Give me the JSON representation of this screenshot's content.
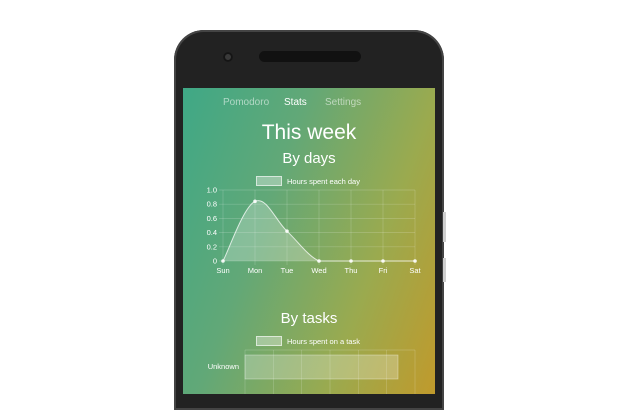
{
  "tabs": [
    "Pomodoro",
    "Stats",
    "Settings"
  ],
  "active_tab": "Stats",
  "page_title": "This week",
  "by_days": {
    "heading": "By days",
    "legend": "Hours spent each day"
  },
  "by_tasks": {
    "heading": "By tasks",
    "legend": "Hours spent on a task",
    "task_label": "Unknown"
  },
  "chart_data": [
    {
      "type": "line",
      "x": [
        "Sun",
        "Mon",
        "Tue",
        "Wed",
        "Thu",
        "Fri",
        "Sat"
      ],
      "series": [
        {
          "name": "Hours spent each day",
          "values": [
            0,
            0.84,
            0.42,
            0,
            0,
            0,
            0
          ]
        }
      ],
      "yticks": [
        "0",
        "0.2",
        "0.4",
        "0.6",
        "0.8",
        "1.0"
      ],
      "ylim": [
        0,
        1.0
      ],
      "grid": true,
      "legend": "top-center"
    },
    {
      "type": "bar",
      "orientation": "horizontal",
      "categories": [
        "Unknown"
      ],
      "series": [
        {
          "name": "Hours spent on a task",
          "values": [
            1.26
          ]
        }
      ],
      "grid": true,
      "legend": "top-center"
    }
  ],
  "colors": {
    "gradient_start": "#3fa886",
    "gradient_end": "#c09a2c",
    "text": "#ffffff"
  }
}
